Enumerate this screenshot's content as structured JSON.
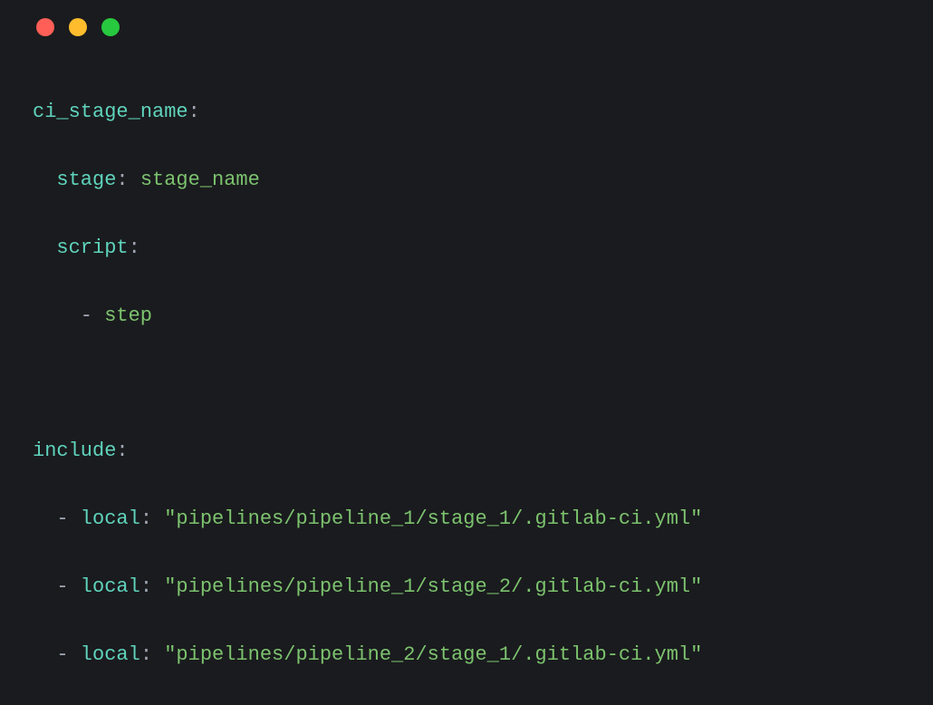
{
  "colors": {
    "bg": "#1a1b1e",
    "red": "#ff5f56",
    "yellow": "#ffbd2e",
    "green": "#27c93f",
    "key": "#5fd3bc",
    "value": "#7cc36e",
    "punct": "#a0a8b4"
  },
  "code": {
    "job_name": "ci_stage_name",
    "stage_key": "stage",
    "stage_value": "stage_name",
    "script_key": "script",
    "script_item": "step",
    "include_key": "include",
    "include_items": [
      {
        "key": "local",
        "path": "\"pipelines/pipeline_1/stage_1/.gitlab-ci.yml\""
      },
      {
        "key": "local",
        "path": "\"pipelines/pipeline_1/stage_2/.gitlab-ci.yml\""
      },
      {
        "key": "local",
        "path": "\"pipelines/pipeline_2/stage_1/.gitlab-ci.yml\""
      }
    ],
    "colon": ":",
    "dash": "-"
  }
}
